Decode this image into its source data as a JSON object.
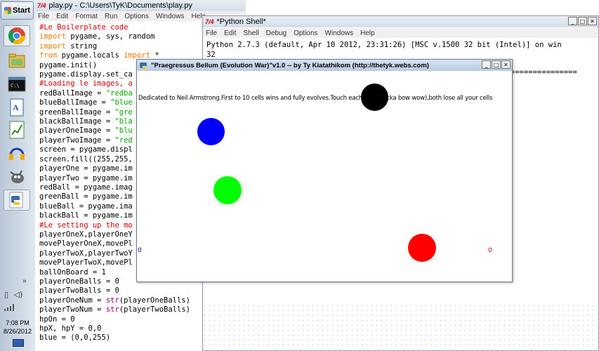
{
  "taskbar": {
    "start_label": "Start",
    "icons": [
      "chrome-icon",
      "folder-icon",
      "terminal-icon",
      "document-icon",
      "chart-icon",
      "headphones-icon",
      "gimp-icon",
      "python-icon"
    ],
    "tray_expand": "»",
    "clock_time": "7:08 PM",
    "clock_date": "8/26/2012"
  },
  "editor": {
    "title": "play.py - C:\\Users\\TyK\\Documents\\play.py",
    "icon_label": "7/4",
    "menu": [
      "File",
      "Edit",
      "Format",
      "Run",
      "Options",
      "Windows",
      "Help"
    ],
    "lines": [
      "#Le Boilerplate code",
      "import pygame, sys, random",
      "import string",
      "from pygame.locals import *",
      "pygame.init()",
      "pygame.display.set_ca",
      "#Loading le images, a",
      "redBallImage = \"redba",
      "blueBallImage = \"blue",
      "greenBallImage = \"gre",
      "blackBallImage = \"bla",
      "playerOneImage = \"blu",
      "playerTwoImage = \"red",
      "screen = pygame.displ",
      "screen.fill((255,255,",
      "playerOne = pygame.im",
      "playerTwo = pygame.im",
      "redBall = pygame.imag",
      "greenBall = pygame.im",
      "blueBall = pygame.ima",
      "blackBall = pygame.im",
      "#Le setting up the mo",
      "playerOneX,playerOneY",
      "movePlayerOneX,movePl",
      "playerTwoX,playerTwoY",
      "movePlayerTwoX,movePl",
      "ballOnBoard = 1",
      "playerOneBalls = 0",
      "playerTwoBalls = 0",
      "playerOneNum = str(playerOneBalls)",
      "playerTwoNum = str(playerTwoBalls)",
      "hpOn = 0",
      "hpX, hpY = 0,0",
      "blue = (0,0,255)"
    ]
  },
  "shell": {
    "title": "*Python Shell*",
    "icon_label": "7/4",
    "menu": [
      "File",
      "Edit",
      "Shell",
      "Debug",
      "Options",
      "Windows",
      "Help"
    ],
    "line1": "Python 2.7.3 (default, Apr 10 2012, 23:31:26) [MSC v.1500 32 bit (Intel)] on win",
    "line2": "32",
    "separator": "==============="
  },
  "game": {
    "title": "\"Praegressus Bellum (Evolution War)\"v1.0 -- by Ty Kiatathikom (http://thetyk.webs.com)",
    "message": "Dedicated to Neil Armstrong.First to 10 cells wins and fully evolves.Touch each         chicka bow wow),both lose all your cells",
    "score_left": "0",
    "score_right": "0",
    "colors": {
      "black_ball": "#000000",
      "blue_ball": "#0000ff",
      "green_ball": "#00ff00",
      "red_ball": "#ff0000"
    }
  },
  "window_buttons": {
    "minimize": "_",
    "maximize": "□",
    "close": "✕"
  }
}
